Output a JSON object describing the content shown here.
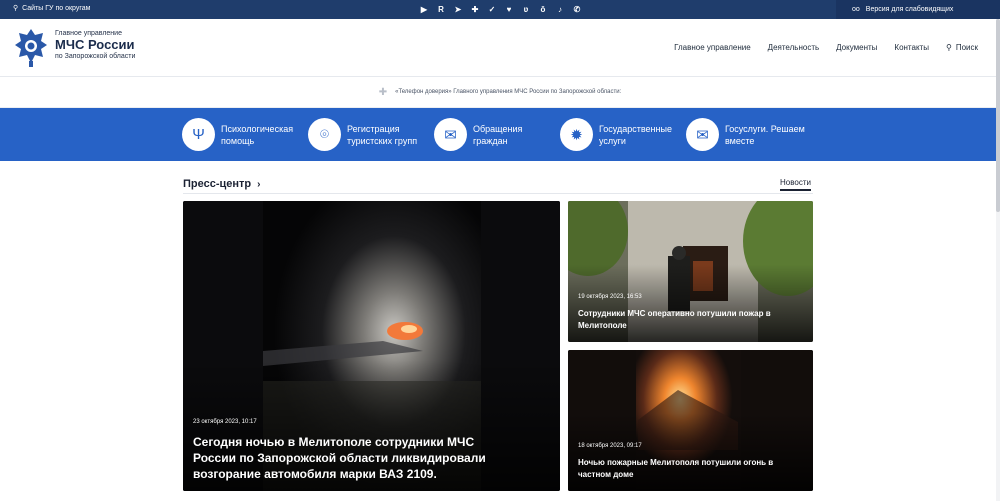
{
  "topbar": {
    "sites_label": "Сайты ГУ по округам",
    "vision_label": "Версия для слабовидящих",
    "socials": [
      "youtube-icon",
      "rutube-icon",
      "telegram-icon",
      "odnoklassniki-icon",
      "twitter-icon",
      "heart-icon",
      "vk-icon",
      "ok-icon",
      "tiktok-icon",
      "viber-icon"
    ]
  },
  "header": {
    "brand_line1": "Главное управление",
    "brand_line2": "МЧС России",
    "brand_line3": "по Запорожской области",
    "nav": [
      "Главное управление",
      "Деятельность",
      "Документы",
      "Контакты"
    ],
    "search_label": "Поиск"
  },
  "trust": {
    "text": "«Телефон доверия» Главного управления МЧС России по Запорожской области:"
  },
  "services": [
    {
      "icon": "psi-icon",
      "glyph": "Ψ",
      "label": "Психологическая\nпомощь"
    },
    {
      "icon": "location-icon",
      "glyph": "⌾",
      "label": "Регистрация\nтуристских групп"
    },
    {
      "icon": "mail-icon",
      "glyph": "✉",
      "label": "Обращения\nграждан"
    },
    {
      "icon": "emblem-icon",
      "glyph": "✹",
      "label": "Государственные\nуслуги"
    },
    {
      "icon": "message-icon",
      "glyph": "✉",
      "label": "Госуслуги. Решаем\nвместе"
    }
  ],
  "press": {
    "title": "Пресс-центр",
    "tab": "Новости",
    "articles": [
      {
        "date": "23 октября 2023, 10:17",
        "headline": "Сегодня ночью в Мелитополе сотрудники МЧС России по Запорожской области ликвидировали возгорание автомобиля марки ВАЗ 2109."
      },
      {
        "date": "19 октября 2023, 16:53",
        "headline": "Сотрудники МЧС оперативно потушили пожар в Мелитополе"
      },
      {
        "date": "18 октября 2023, 09:17",
        "headline": "Ночью пожарные Мелитополя потушили огонь в частном доме"
      }
    ]
  },
  "colors": {
    "topbar": "#1f3d6c",
    "services_band": "#2762c6",
    "text_dark": "#1b2233"
  }
}
